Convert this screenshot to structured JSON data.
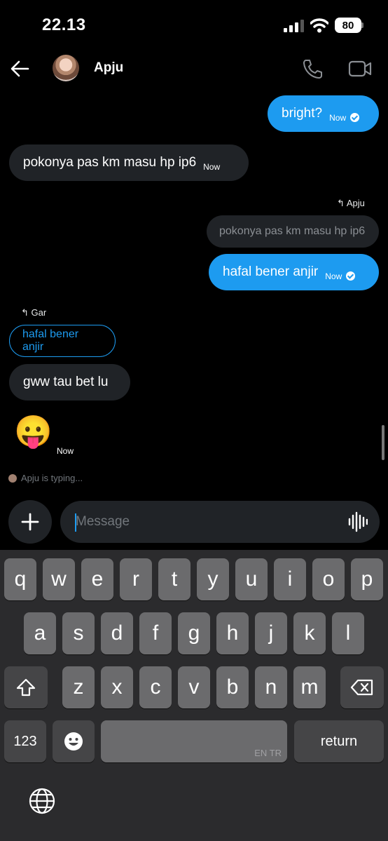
{
  "status_bar": {
    "time": "22.13",
    "battery": "80"
  },
  "header": {
    "contact_name": "Apju"
  },
  "messages": [
    {
      "id": "m1",
      "direction": "out",
      "text": "bright?",
      "time": "Now"
    },
    {
      "id": "m2",
      "direction": "in",
      "text": "pokonya pas km masu hp ip6",
      "time": "Now"
    },
    {
      "id": "m3",
      "direction": "out",
      "reply_to": "Apju",
      "quoted": "pokonya pas km masu hp ip6",
      "text": "hafal bener anjir",
      "time": "Now"
    },
    {
      "id": "m4",
      "direction": "in",
      "reply_to": "Gar",
      "quoted": "hafal bener anjir",
      "text": "gww tau bet lu"
    },
    {
      "id": "m5",
      "direction": "in",
      "text": "😛",
      "time": "Now"
    }
  ],
  "typing_indicator": "Apju is typing...",
  "composer": {
    "placeholder": "Message"
  },
  "keyboard": {
    "row1": [
      "q",
      "w",
      "e",
      "r",
      "t",
      "y",
      "u",
      "i",
      "o",
      "p"
    ],
    "row2": [
      "a",
      "s",
      "d",
      "f",
      "g",
      "h",
      "j",
      "k",
      "l"
    ],
    "row3": [
      "z",
      "x",
      "c",
      "v",
      "b",
      "n",
      "m"
    ],
    "numbers_label": "123",
    "return_label": "return",
    "space_hint": "EN TR"
  },
  "colors": {
    "accent": "#1d9bf0",
    "incoming_bubble": "#202327",
    "background": "#000000"
  }
}
